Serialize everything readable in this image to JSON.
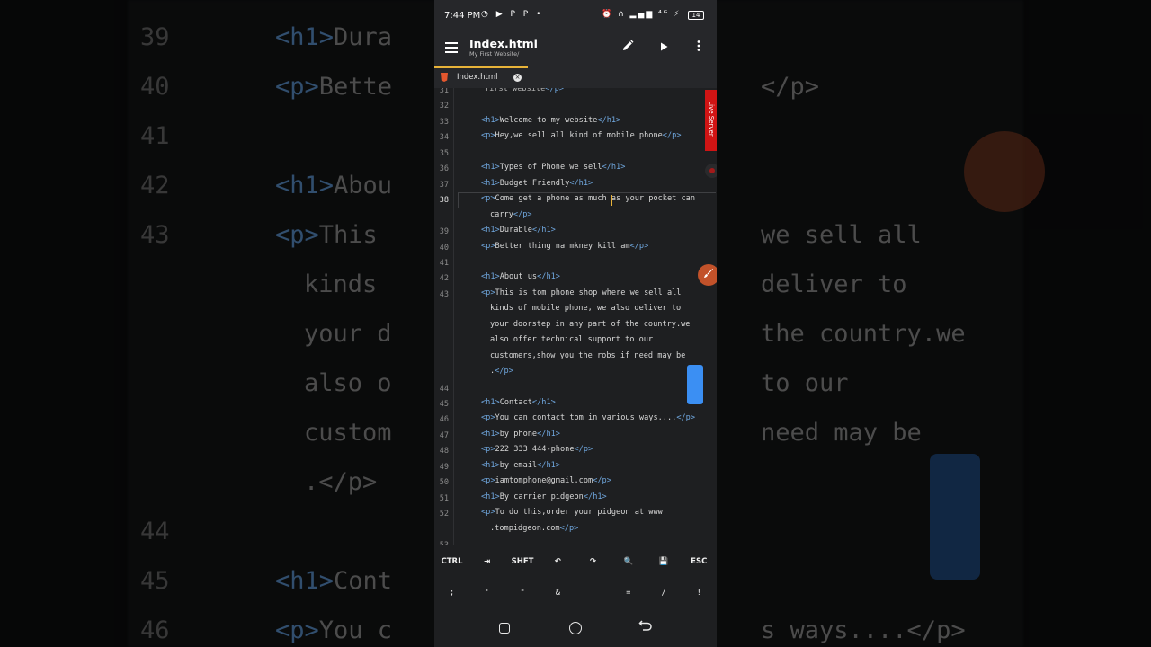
{
  "background_mirror": {
    "lines": [
      {
        "num": "39",
        "tag_open": "<h1>",
        "text": "Dura",
        "tag_close": ""
      },
      {
        "num": "40",
        "tag_open": "<p>",
        "text": "Bette",
        "tag_close": "</p>"
      },
      {
        "num": "41",
        "tag_open": "",
        "text": "",
        "tag_close": ""
      },
      {
        "num": "42",
        "tag_open": "<h1>",
        "text": "Abou",
        "tag_close": ""
      },
      {
        "num": "43",
        "tag_open": "<p>",
        "text": "This",
        "tag_close": "we sell all"
      },
      {
        "num": "",
        "tag_open": "",
        "text": "kinds",
        "tag_close": "deliver to"
      },
      {
        "num": "",
        "tag_open": "",
        "text": "your d",
        "tag_close": "the country.we"
      },
      {
        "num": "",
        "tag_open": "",
        "text": "also o",
        "tag_close": "to our"
      },
      {
        "num": "",
        "tag_open": "",
        "text": "custom",
        "tag_close": "need may be"
      },
      {
        "num": "",
        "tag_open": "",
        "text": ".</p>",
        "tag_close": ""
      },
      {
        "num": "44",
        "tag_open": "",
        "text": "",
        "tag_close": ""
      },
      {
        "num": "45",
        "tag_open": "<h1>",
        "text": "Cont",
        "tag_close": ""
      },
      {
        "num": "46",
        "tag_open": "<p>",
        "text": "You c",
        "tag_close": "s ways....</p>"
      }
    ]
  },
  "statusbar": {
    "time": "7:44 PM",
    "left_icons": "◔ ▶ P P •",
    "right_icons": "⏰ ∩ ▂▄▆ ⁴ᴳ ⚡",
    "battery": "14"
  },
  "appbar": {
    "title": "Index.html",
    "subtitle": "My First Website/",
    "icons": [
      "menu-icon",
      "edit-icon",
      "play-icon",
      "more-icon"
    ]
  },
  "tabs": [
    {
      "label": "Index.html",
      "icon": "html5-icon",
      "active": true
    }
  ],
  "editor": {
    "current_line": "38",
    "live_server_label": "Live Server",
    "lines": [
      {
        "num": "31",
        "parts": [
          [
            "t",
            "first website"
          ],
          [
            "g",
            "</p>"
          ]
        ],
        "wrap": true
      },
      {
        "num": "32",
        "parts": []
      },
      {
        "num": "33",
        "parts": [
          [
            "g",
            "<h1>"
          ],
          [
            "t",
            "Welcome to my website"
          ],
          [
            "g",
            "</h1>"
          ]
        ]
      },
      {
        "num": "34",
        "parts": [
          [
            "g",
            "<p>"
          ],
          [
            "t",
            "Hey,we sell all kind of mobile phone"
          ],
          [
            "g",
            "</p>"
          ]
        ]
      },
      {
        "num": "35",
        "parts": []
      },
      {
        "num": "36",
        "parts": [
          [
            "g",
            "<h1>"
          ],
          [
            "t",
            "Types of Phone we sell"
          ],
          [
            "g",
            "</h1>"
          ]
        ]
      },
      {
        "num": "37",
        "parts": [
          [
            "g",
            "<h1>"
          ],
          [
            "t",
            "Budget Friendly"
          ],
          [
            "g",
            "</h1>"
          ]
        ]
      },
      {
        "num": "38",
        "parts": [
          [
            "g",
            "<p>"
          ],
          [
            "t",
            "Come get a phone as much as your pocket can"
          ]
        ]
      },
      {
        "num": "",
        "parts": [
          [
            "t",
            "carry"
          ],
          [
            "g",
            "</p>"
          ]
        ],
        "wrap": true
      },
      {
        "num": "39",
        "parts": [
          [
            "g",
            "<h1>"
          ],
          [
            "t",
            "Durable"
          ],
          [
            "g",
            "</h1>"
          ]
        ]
      },
      {
        "num": "40",
        "parts": [
          [
            "g",
            "<p>"
          ],
          [
            "t",
            "Better thing na mkney kill am"
          ],
          [
            "g",
            "</p>"
          ]
        ]
      },
      {
        "num": "41",
        "parts": []
      },
      {
        "num": "42",
        "parts": [
          [
            "g",
            "<h1>"
          ],
          [
            "t",
            "About us"
          ],
          [
            "g",
            "</h1>"
          ]
        ]
      },
      {
        "num": "43",
        "parts": [
          [
            "g",
            "<p>"
          ],
          [
            "t",
            "This is tom phone shop where we sell all"
          ]
        ]
      },
      {
        "num": "",
        "parts": [
          [
            "t",
            "kinds of mobile phone, we also deliver to"
          ]
        ],
        "wrap": true
      },
      {
        "num": "",
        "parts": [
          [
            "t",
            "your doorstep in any part of the country.we"
          ]
        ],
        "wrap": true
      },
      {
        "num": "",
        "parts": [
          [
            "t",
            "also offer technical support to our"
          ]
        ],
        "wrap": true
      },
      {
        "num": "",
        "parts": [
          [
            "t",
            "customers,show you the robs if need may be"
          ]
        ],
        "wrap": true
      },
      {
        "num": "",
        "parts": [
          [
            "t",
            "."
          ],
          [
            "g",
            "</p>"
          ]
        ],
        "wrap": true
      },
      {
        "num": "44",
        "parts": []
      },
      {
        "num": "45",
        "parts": [
          [
            "g",
            "<h1>"
          ],
          [
            "t",
            "Contact"
          ],
          [
            "g",
            "</h1>"
          ]
        ]
      },
      {
        "num": "46",
        "parts": [
          [
            "g",
            "<p>"
          ],
          [
            "t",
            "You can contact tom in various ways...."
          ],
          [
            "g",
            "</p>"
          ]
        ]
      },
      {
        "num": "47",
        "parts": [
          [
            "g",
            "<h1>"
          ],
          [
            "t",
            "by phone"
          ],
          [
            "g",
            "</h1>"
          ]
        ]
      },
      {
        "num": "48",
        "parts": [
          [
            "g",
            "<p>"
          ],
          [
            "t",
            "222 333 444-phone"
          ],
          [
            "g",
            "</p>"
          ]
        ]
      },
      {
        "num": "49",
        "parts": [
          [
            "g",
            "<h1>"
          ],
          [
            "t",
            "by email"
          ],
          [
            "g",
            "</h1>"
          ]
        ]
      },
      {
        "num": "50",
        "parts": [
          [
            "g",
            "<p>"
          ],
          [
            "t",
            "iamtomphone@gmail.com"
          ],
          [
            "g",
            "</p>"
          ]
        ]
      },
      {
        "num": "51",
        "parts": [
          [
            "g",
            "<h1>"
          ],
          [
            "t",
            "By carrier pidgeon"
          ],
          [
            "g",
            "</h1>"
          ]
        ]
      },
      {
        "num": "52",
        "parts": [
          [
            "g",
            "<p>"
          ],
          [
            "t",
            "To do this,order your pidgeon at www"
          ]
        ]
      },
      {
        "num": "",
        "parts": [
          [
            "t",
            ".tompidgeon.com"
          ],
          [
            "g",
            "</p>"
          ]
        ],
        "wrap": true
      },
      {
        "num": "53",
        "parts": []
      }
    ]
  },
  "keybar": {
    "row1": [
      "CTRL",
      "⇥",
      "SHFT",
      "↶",
      "↷",
      "🔍",
      "💾",
      "ESC"
    ],
    "row1_names": [
      "ctrl-key",
      "tab-key-icon",
      "shift-key",
      "undo-icon",
      "redo-icon",
      "search-icon",
      "save-icon",
      "esc-key"
    ],
    "row2": [
      ";",
      "'",
      "\"",
      "&",
      "|",
      "=",
      "/",
      "!"
    ]
  },
  "navbar": {
    "icons": [
      "recents-icon",
      "home-icon",
      "back-icon"
    ]
  },
  "colors": {
    "accent": "#e8b339",
    "tag": "#6fa6dd",
    "live_server": "#d01414",
    "scroll_thumb": "#3b8ff3",
    "brush": "#c2522a"
  }
}
